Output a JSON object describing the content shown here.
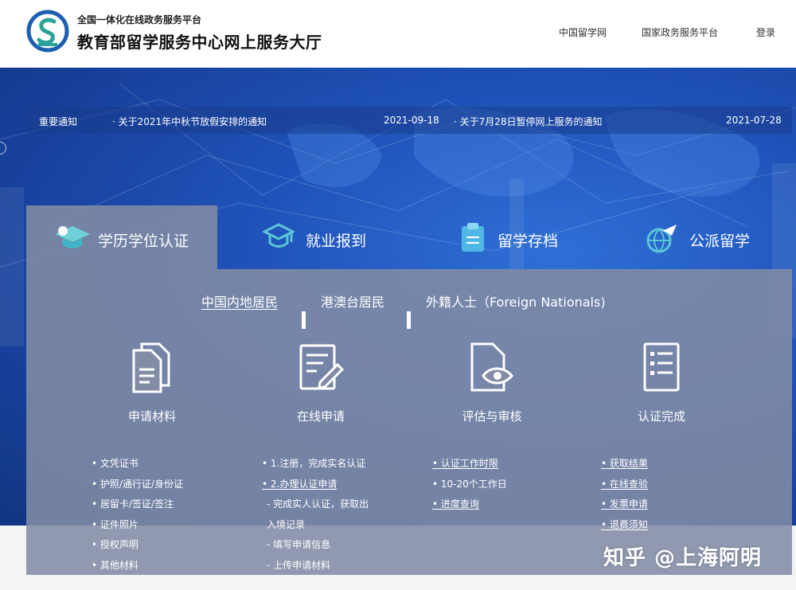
{
  "header": {
    "platform": "全国一体化在线政务服务平台",
    "title": "教育部留学服务中心网上服务大厅",
    "nav": [
      "中国留学网",
      "国家政务服务平台",
      "登录"
    ]
  },
  "notice": {
    "label": "重要通知",
    "items": [
      {
        "text": "· 关于2021年中秋节放假安排的通知",
        "date": "2021-09-18"
      },
      {
        "text": "· 关于7月28日暂停网上服务的通知",
        "date": "2021-07-28"
      }
    ]
  },
  "tabs": [
    "学历学位认证",
    "就业报到",
    "留学存档",
    "公派留学"
  ],
  "subtabs": [
    "中国内地居民",
    "港澳台居民",
    "外籍人士（Foreign Nationals)"
  ],
  "steps": [
    "申请材料",
    "在线申请",
    "评估与审核",
    "认证完成"
  ],
  "lists": {
    "materials": [
      "• 文凭证书",
      "• 护照/通行证/身份证",
      "• 居留卡/签证/签注",
      "• 证件照片",
      "• 授权声明",
      "• 其他材料"
    ],
    "apply": [
      "• 1.注册，完成实名认证",
      "• 2.办理认证申请",
      "- 完成实人认证，获取出",
      "入境记录",
      "- 填写申请信息",
      "- 上传申请材料"
    ],
    "review": [
      "• 认证工作时限",
      "• 10-20个工作日",
      "• 进度查询"
    ],
    "complete": [
      "• 获取结果",
      "• 在线查验",
      "• 发票申请",
      "• 退费须知"
    ]
  },
  "watermark": "知乎 @上海阿明",
  "colors": {
    "banner": "#1f52b8",
    "panel": "#828ca5",
    "accent": "#3fb6c8"
  }
}
